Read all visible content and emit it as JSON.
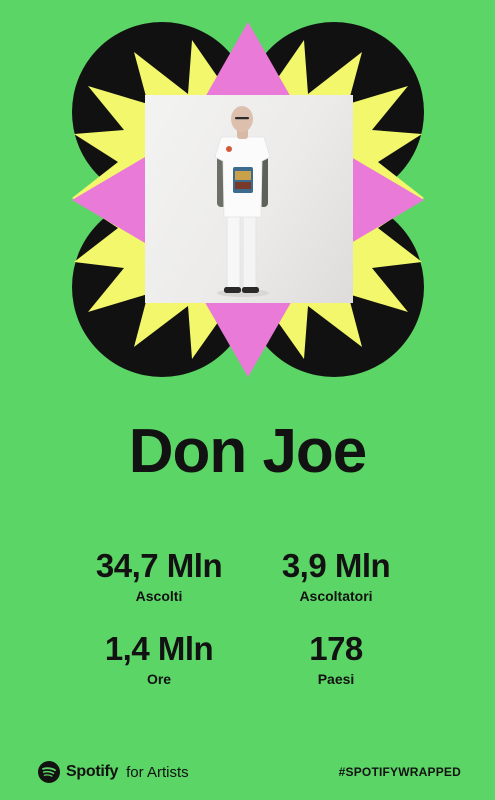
{
  "artist": {
    "name": "Don Joe",
    "photo_icon": "artist-photo"
  },
  "stats": [
    {
      "value": "34,7 Mln",
      "label": "Ascolti"
    },
    {
      "value": "3,9 Mln",
      "label": "Ascoltatori"
    },
    {
      "value": "1,4 Mln",
      "label": "Ore"
    },
    {
      "value": "178",
      "label": "Paesi"
    }
  ],
  "footer": {
    "brand_icon": "spotify-logo-icon",
    "brand_name": "Spotify",
    "brand_sub": "for Artists",
    "hashtag": "#SPOTIFYWRAPPED"
  },
  "colors": {
    "background": "#5bd565",
    "burst_black": "#111111",
    "burst_yellow": "#f2f76b",
    "burst_pink": "#e97ad8",
    "text": "#121212"
  }
}
